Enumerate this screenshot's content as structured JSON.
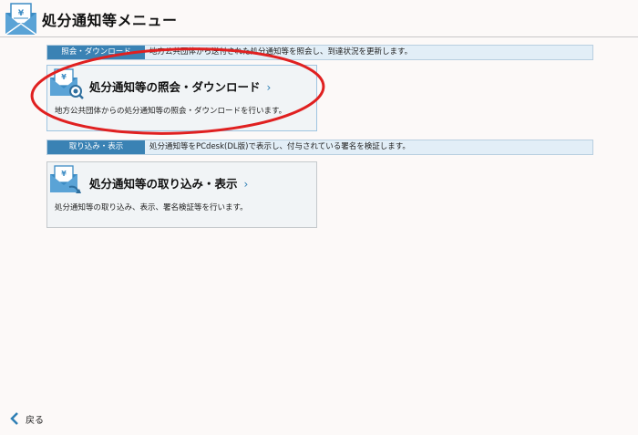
{
  "header": {
    "title": "処分通知等メニュー",
    "icon": "envelope-document-icon"
  },
  "sections": [
    {
      "bar_label": "照会・ダウンロード",
      "bar_description": "地方公共団体から送付された処分通知等を照会し、到達状況を更新します。",
      "card": {
        "title": "処分通知等の照会・ダウンロード",
        "description": "地方公共団体からの処分通知等の照会・ダウンロードを行います。",
        "icon": "envelope-search-icon"
      }
    },
    {
      "bar_label": "取り込み・表示",
      "bar_description": "処分通知等をPCdesk(DL版)で表示し、付与されている署名を検証します。",
      "card": {
        "title": "処分通知等の取り込み・表示",
        "description": "処分通知等の取り込み、表示、署名検証等を行います。",
        "icon": "envelope-import-icon"
      }
    }
  ],
  "footer": {
    "back_label": "戻る"
  },
  "colors": {
    "accent": "#3a82b4",
    "bar_background": "#e2eef7",
    "annotation": "#e02020"
  }
}
